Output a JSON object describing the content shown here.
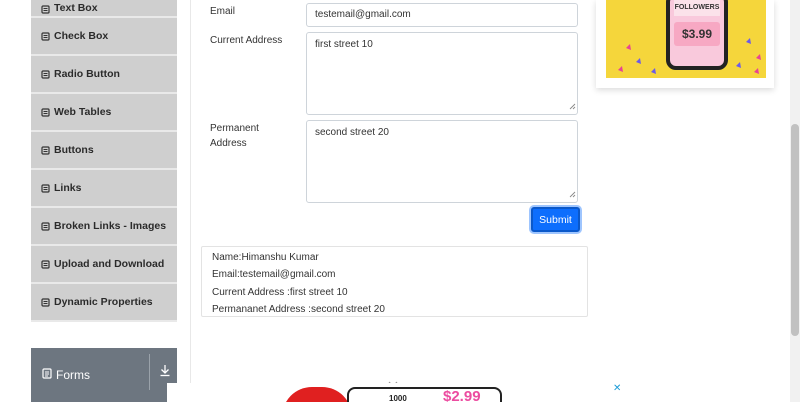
{
  "sidebar": {
    "items": [
      {
        "label": "Text Box"
      },
      {
        "label": "Check Box"
      },
      {
        "label": "Radio Button"
      },
      {
        "label": "Web Tables"
      },
      {
        "label": "Buttons"
      },
      {
        "label": "Links"
      },
      {
        "label": "Broken Links - Images"
      },
      {
        "label": "Upload and Download"
      },
      {
        "label": "Dynamic Properties"
      }
    ],
    "forms_label": "Forms"
  },
  "form": {
    "email_label": "Email",
    "email_value": "testemail@gmail.com",
    "current_address_label": "Current Address",
    "current_address_value": "first street 10",
    "permanent_address_label_line1": "Permanent",
    "permanent_address_label_line2": "Address",
    "permanent_address_value": "second street 20",
    "submit_label": "Submit"
  },
  "output": {
    "name": "Name:Himanshu Kumar",
    "email": "Email:testemail@gmail.com",
    "current_address": "Current Address :first street 10",
    "permanent_address": "Permananet Address :second street 20"
  },
  "ad": {
    "followers": "FOLLOWERS",
    "price": "$3.99"
  },
  "banner": {
    "number": "1000",
    "price": "$2.99",
    "close": "✕"
  },
  "colors": {
    "accent": "#0d6efd",
    "sidebar_bg": "#cfcfcf",
    "forms_bg": "#6d7680",
    "ad_bg": "#f5d63b"
  }
}
